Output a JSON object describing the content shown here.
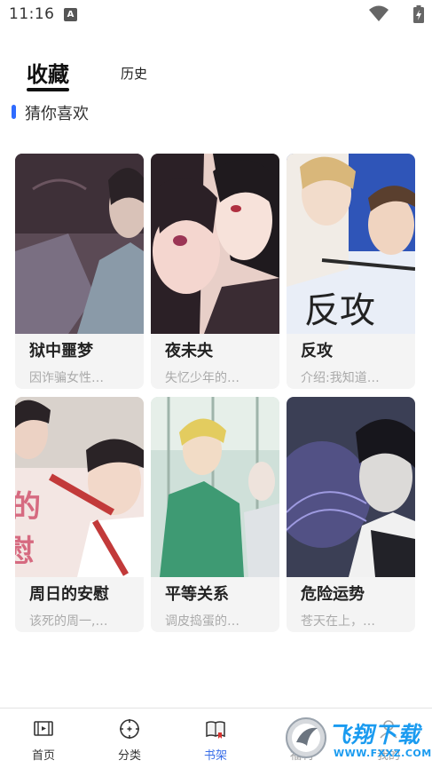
{
  "status_bar": {
    "time": "11:16",
    "notification_icon": "A"
  },
  "tabs": {
    "favorites": "收藏",
    "history": "历史"
  },
  "section": {
    "title": "猜你喜欢"
  },
  "comics": [
    {
      "title": "狱中噩梦",
      "desc": "因诈骗女性…"
    },
    {
      "title": "夜未央",
      "desc": "失忆少年的…"
    },
    {
      "title": "反攻",
      "desc": "介绍:我知道…"
    },
    {
      "title": "周日的安慰",
      "desc": "该死的周一,…"
    },
    {
      "title": "平等关系",
      "desc": "调皮捣蛋的…"
    },
    {
      "title": "危险运势",
      "desc": "苍天在上，…"
    }
  ],
  "nav": [
    {
      "label": "首页",
      "icon": "film-icon"
    },
    {
      "label": "分类",
      "icon": "compass-icon"
    },
    {
      "label": "书架",
      "icon": "book-icon"
    },
    {
      "label": "福利",
      "icon": "gift-icon"
    },
    {
      "label": "我的",
      "icon": "user-icon"
    }
  ],
  "watermark": {
    "title": "飞翔下载",
    "url": "WWW.FXXZ.COM"
  },
  "colors": {
    "accent": "#3b6fe8",
    "section_bar": "#2f6bff",
    "watermark": "#1a9bf0"
  }
}
